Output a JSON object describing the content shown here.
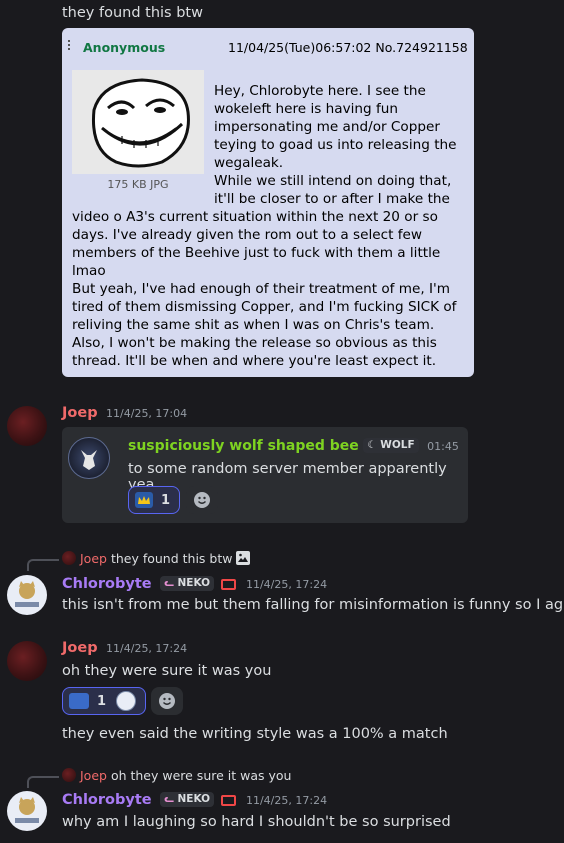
{
  "top_text": "they found this btw",
  "post": {
    "name": "Anonymous",
    "datetime": "11/04/25(Tue)06:57:02",
    "number": "No.724921158",
    "file_size": "175 KB JPG",
    "para1": "Hey, Chlorobyte here. I see the wokeleft here is having fun impersonating me and/or Copper teying to goad us into releasing the wegaleak.",
    "para2": "While we still intend on doing that, it'll be closer to or after I make the video o A3's current situation within the next 20 or so days. I've already given the rom out to a select few members of the Beehive just to fuck with them a little lmao",
    "para3": "But yeah, I've had enough of their treatment of me, I'm tired of them dismissing Copper, and I'm fucking SICK of reliving the same shit as when I was on Chris's team. Also, I won't be making the release so obvious as this thread. It'll be when and where you're least expect it."
  },
  "messages": [
    {
      "author": "Joep",
      "timestamp": "11/4/25, 17:04",
      "embed": {
        "author": "suspiciously wolf shaped bee",
        "tag": "WOLF",
        "time": "01:45",
        "text": "to some random server member apparently yea",
        "reaction_count": "1"
      }
    },
    {
      "reply_author": "Joep",
      "reply_text": "they found this btw",
      "author": "Chlorobyte",
      "tag": "NEKO",
      "timestamp": "11/4/25, 17:24",
      "text": "this isn't from me but them falling for misinformation is funny so I agree"
    },
    {
      "author": "Joep",
      "timestamp": "11/4/25, 17:24",
      "text": "oh they were sure it was you",
      "reaction_count": "1",
      "text2": "they even said the writing style was a 100% a match"
    },
    {
      "reply_author": "Joep",
      "reply_text": "oh they were sure it was you",
      "author": "Chlorobyte",
      "tag": "NEKO",
      "timestamp": "11/4/25, 17:24",
      "text": "why am I laughing so hard I shouldn't be so surprised"
    }
  ],
  "colors": {
    "background": "#1a1a1e",
    "joep": "#f06a6a",
    "chlorobyte": "#a87bf5",
    "embed_author": "#7ed321",
    "post_bg": "#d6daf0",
    "post_name": "#117743"
  },
  "icons": [
    "troll-face-image",
    "image-icon",
    "smiley-add-reaction-icon",
    "monitor-icon",
    "cat-badge-icon",
    "wolf-badge-icon"
  ]
}
